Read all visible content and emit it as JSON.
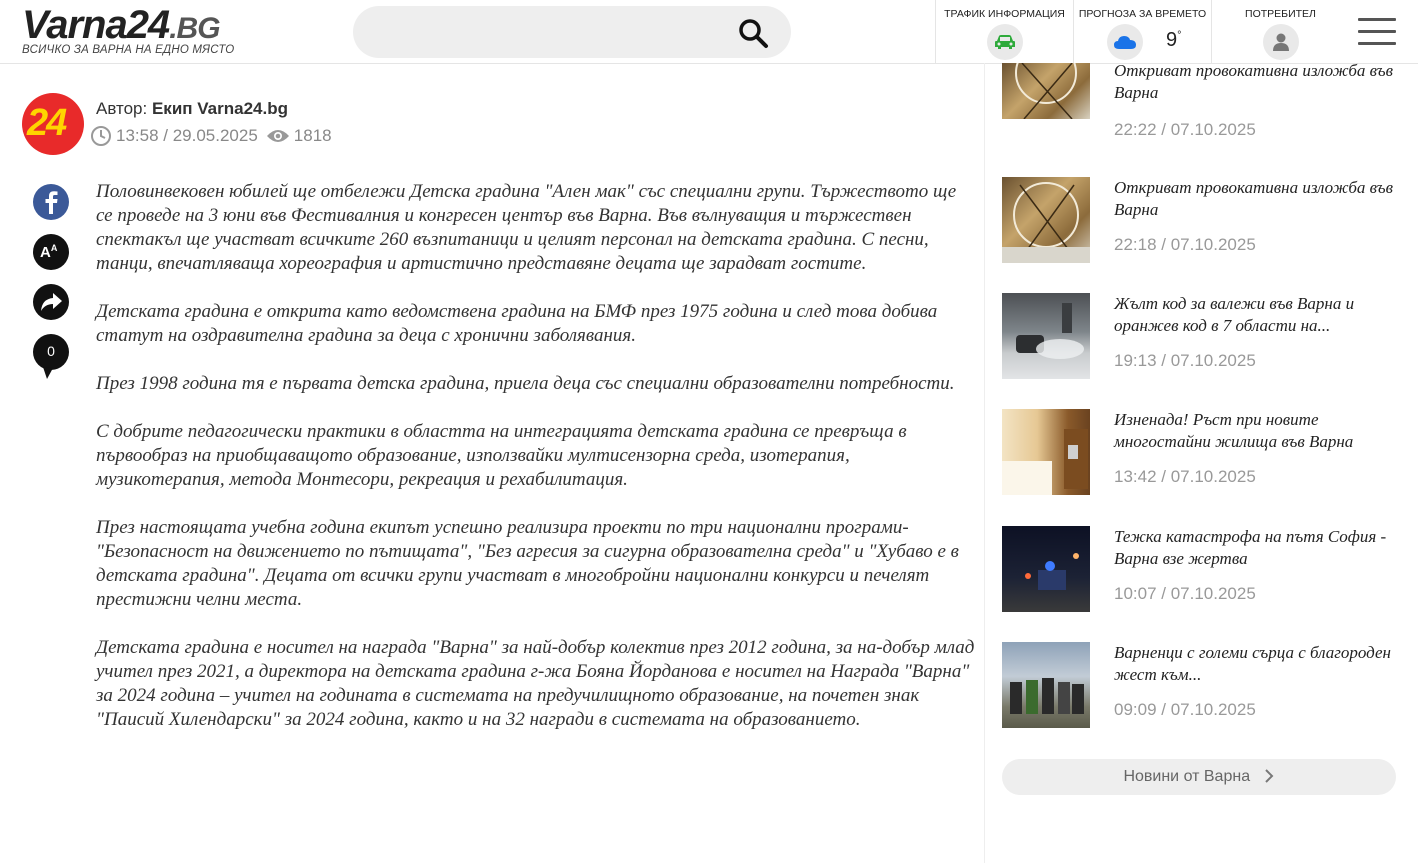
{
  "header": {
    "logo_main": "Varna24",
    "logo_suffix": ".BG",
    "logo_tagline": "ВСИЧКО ЗА ВАРНА НА ЕДНО МЯСТО",
    "traffic_label": "ТРАФИК ИНФОРМАЦИЯ",
    "weather_label": "ПРОГНОЗА ЗА ВРЕМЕТО",
    "weather_temp": "9",
    "weather_unit": "°",
    "user_label": "ПОТРЕБИТЕЛ"
  },
  "article_meta": {
    "author_prefix": "Автор:",
    "author_name": "Екип Varna24.bg",
    "time": "13:58 / 29.05.2025",
    "views": "1818",
    "avatar_text": "24",
    "comments_count": "0"
  },
  "article": {
    "paragraphs": [
      "Половинвековен юбилей ще отбележи Детска градина \"Ален мак\" със специални групи. Тържеството ще се проведе на 3 юни във Фестивалния и конгресен център във Варна. Във вълнуващия и тържествен спектакъл ще участват всичките 260 възпитаници и целият персонал на детската градина. С песни, танци, впечатляваща хореография и артистично представяне децата ще зарадват гостите.",
      "Детската градина е открита като ведомствена градина на БМФ през 1975 година и след това добива статут на оздравителна градина за деца с хронични заболявания.",
      "През 1998 година тя е първата детска градина, приела деца със специални образователни потребности.",
      "С добрите педагогически практики в областта на интеграцията детската градина се превръща в първообраз на приобщаващото образование, използвайки мултисензорна среда, изотерапия, музикотерапия, метода Монтесори, рекреация и рехабилитация.",
      "През настоящата учебна година екипът успешно реализира проекти по три национални програми- \"Безопасност на движението по пътищата\", \"Без агресия за сигурна образователна среда\" и \"Хубаво е в детската градина\". Децата от всички групи участват в многобройни национални конкурси и печелят престижни челни места.",
      "Детската градина е носител на награда \"Варна\" за най-добър колектив през 2012 година, за на-добър млад учител през 2021, а директора на детската градина г-жа Бояна Йорданова е носител на Награда \"Варна\" за 2024 година – учител на годината в системата на предучилищното образование, на почетен знак \"Паисий Хилендарски\" за 2024 година, както и на 32 награди в системата на образованието."
    ]
  },
  "sidebar": {
    "news": [
      {
        "title": "Откриват провокативна изложба във Варна",
        "time": "22:22 / 07.10.2025"
      },
      {
        "title": "Откриват провокативна изложба във Варна",
        "time": "22:18 / 07.10.2025"
      },
      {
        "title": "Жълт код за валежи във Варна и оранжев код в 7 области на...",
        "time": "19:13 / 07.10.2025"
      },
      {
        "title": "Изненада! Ръст при новите многостайни жилища във Варна",
        "time": "13:42 / 07.10.2025"
      },
      {
        "title": "Тежка катастрофа на пътя София - Варна взе жертва",
        "time": "10:07 / 07.10.2025"
      },
      {
        "title": "Варненци с големи сърца с благороден жест към...",
        "time": "09:09 / 07.10.2025"
      }
    ],
    "more_label": "Новини от Варна"
  },
  "colors": {
    "facebook": "#3b5998",
    "avatar_bg": "#e82a2a",
    "traffic_green": "#2eaa3b",
    "weather_blue": "#1a73e8"
  }
}
